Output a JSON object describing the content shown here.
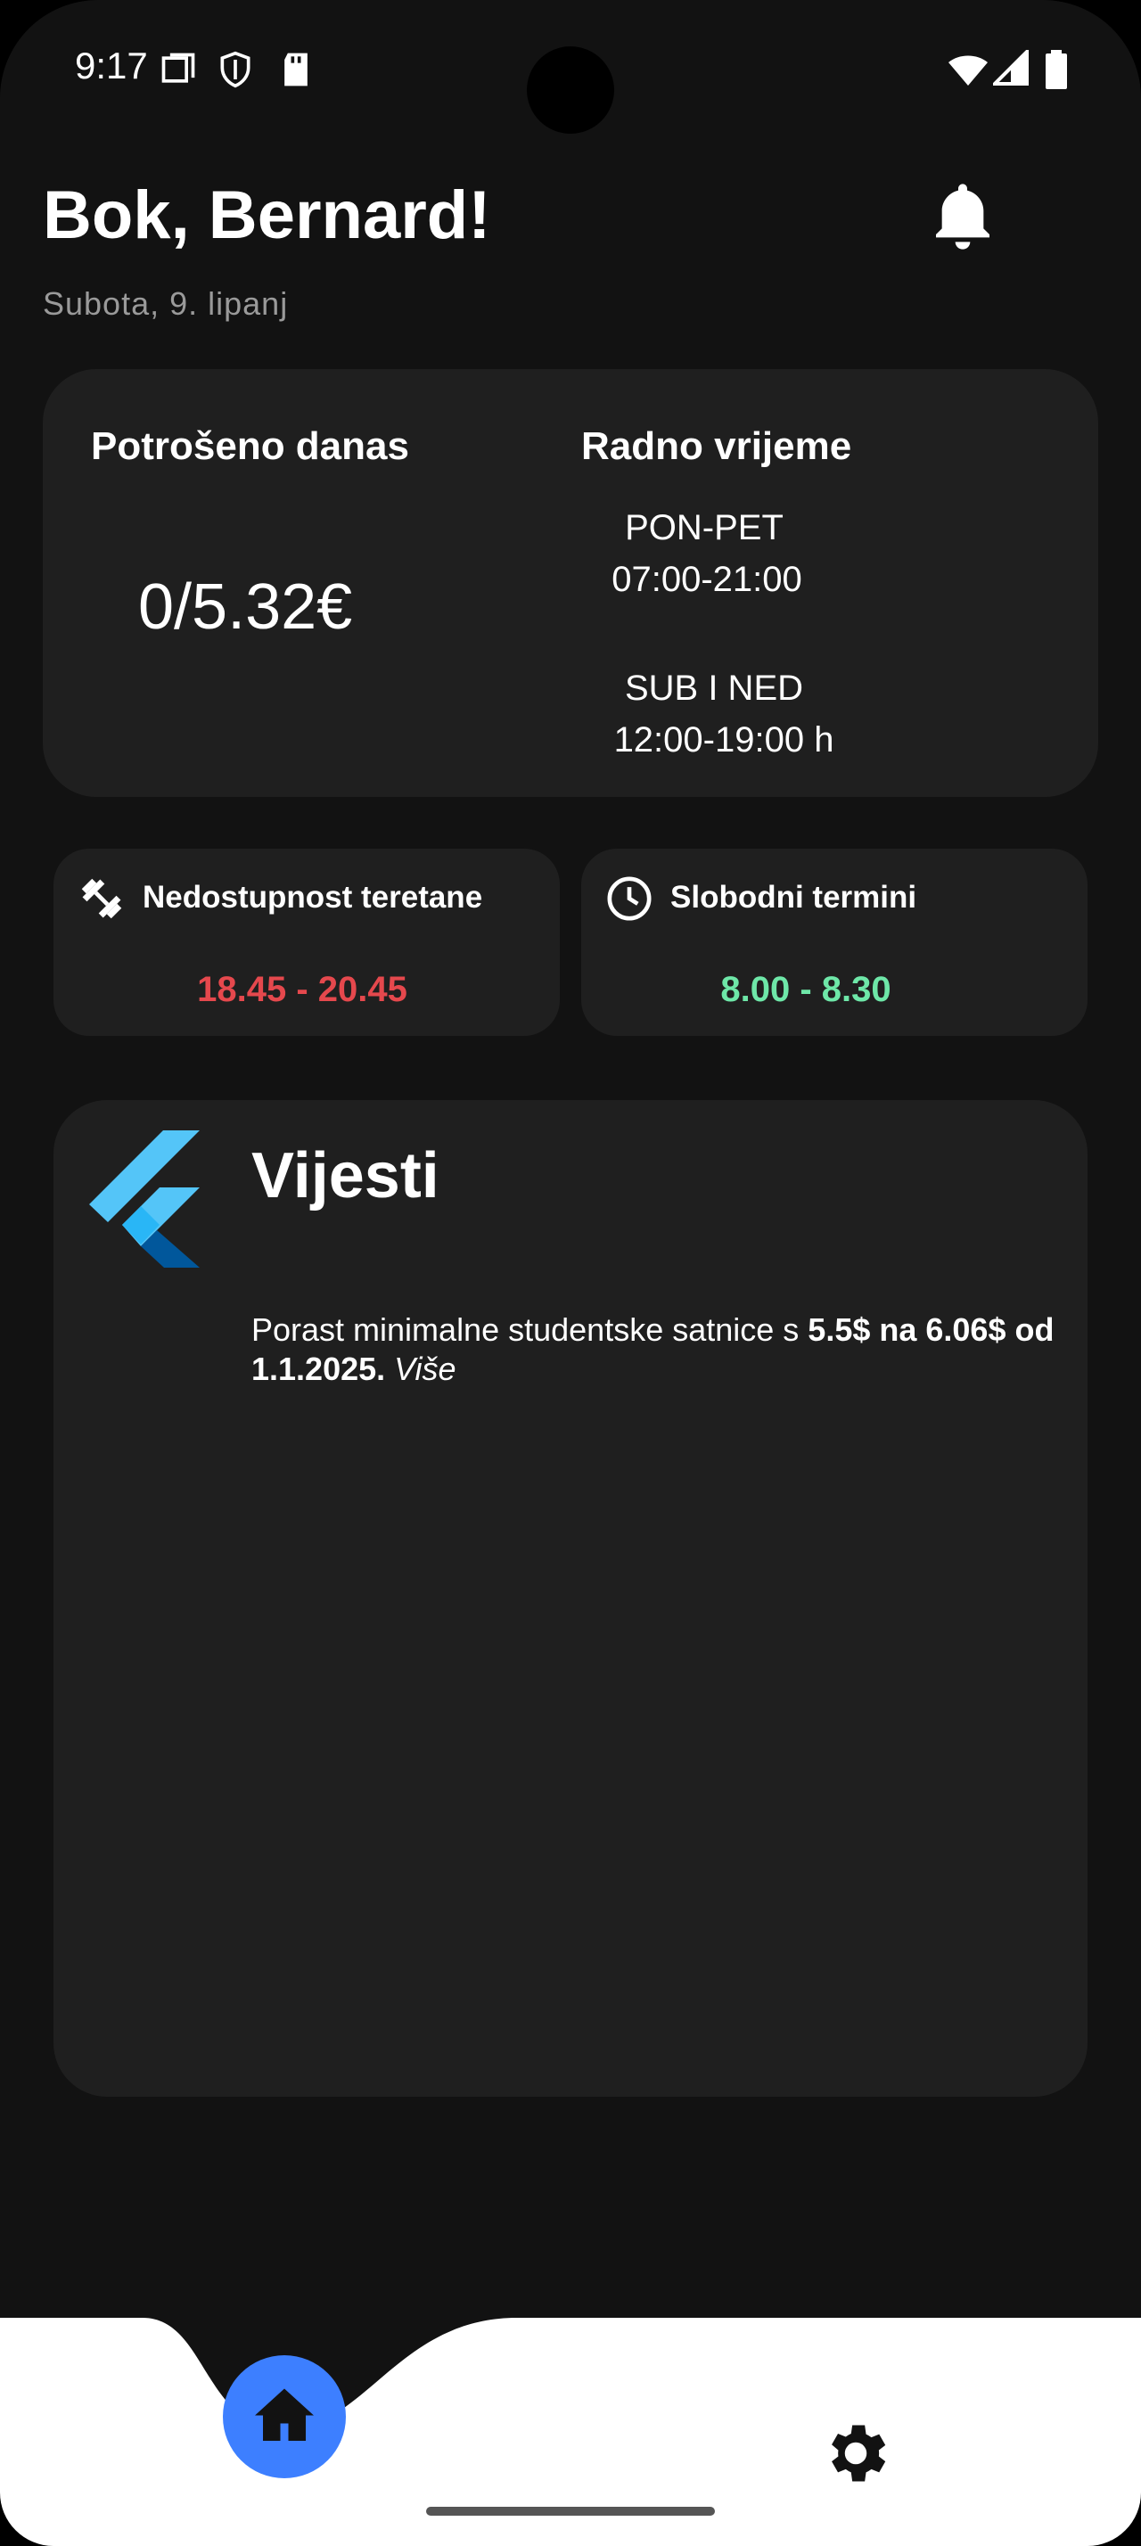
{
  "status_bar": {
    "time": "9:17"
  },
  "header": {
    "greeting": "Bok, Bernard!",
    "date": "Subota, 9. lipanj"
  },
  "summary_card": {
    "spent_title": "Potrošeno danas",
    "spent_value": "0/5.32€",
    "hours_title": "Radno vrijeme",
    "weekday_label": "PON-PET",
    "weekday_hours": "07:00-21:00",
    "weekend_label": "SUB I NED",
    "weekend_hours": "12:00-19:00 h"
  },
  "gym_card": {
    "title": "Nedostupnost teretane",
    "value": "18.45 - 20.45",
    "color": "#e5484d"
  },
  "slots_card": {
    "title": "Slobodni termini",
    "value": "8.00 - 8.30",
    "color": "#6ee7a8"
  },
  "news": {
    "title": "Vijesti",
    "text_prefix": "Porast minimalne studentske satnice s ",
    "text_bold": "5.5$ na 6.06$ od 1.1.2025.",
    "more_link": "Više"
  },
  "colors": {
    "accent": "#3d7fff",
    "background": "#121212",
    "card": "#1f1f1f"
  },
  "icons": [
    "bell-icon",
    "fitness-icon",
    "clock-icon",
    "flutter-logo-icon",
    "home-icon",
    "gear-icon"
  ]
}
